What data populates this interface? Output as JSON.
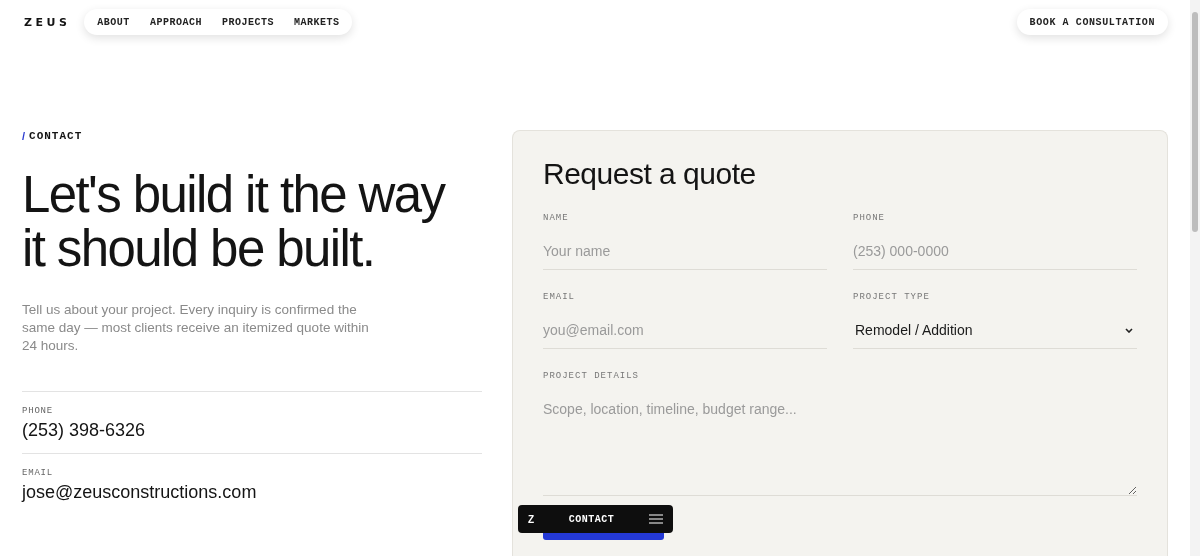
{
  "brand": "ZEUS",
  "nav": [
    "ABOUT",
    "APPROACH",
    "PROJECTS",
    "MARKETS"
  ],
  "cta": "BOOK A CONSULTATION",
  "section_label": {
    "mark": "/",
    "text": "CONTACT"
  },
  "headline": [
    "Let's build it the way",
    "it should be built."
  ],
  "intro": "Tell us about your project. Every inquiry is confirmed the same day — most clients receive an itemized quote within 24 hours.",
  "contacts": [
    {
      "label": "PHONE",
      "value": "(253) 398-6326"
    },
    {
      "label": "EMAIL",
      "value": "jose@zeusconstructions.com"
    }
  ],
  "form": {
    "title": "Request a quote",
    "fields": [
      {
        "kind": "input",
        "label": "NAME",
        "placeholder": "Your name"
      },
      {
        "kind": "input",
        "label": "PHONE",
        "placeholder": "(253) 000-0000"
      },
      {
        "kind": "input",
        "label": "EMAIL",
        "placeholder": "you@email.com"
      },
      {
        "kind": "select",
        "label": "PROJECT TYPE",
        "value": "Remodel / Addition"
      },
      {
        "kind": "textarea",
        "label": "PROJECT DETAILS",
        "placeholder": "Scope, location, timeline, budget range..."
      }
    ]
  },
  "floating_bar": {
    "brand": "Z",
    "label": "CONTACT"
  }
}
